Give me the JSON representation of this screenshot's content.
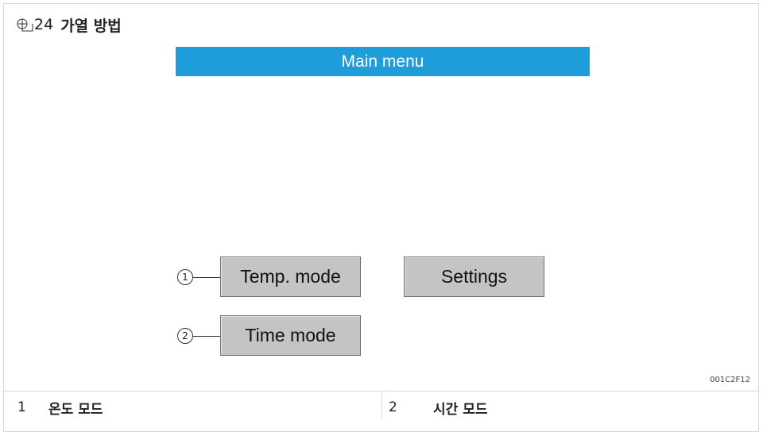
{
  "figure": {
    "number": "24",
    "title": "가열 방법",
    "code": "001C2F12"
  },
  "screen": {
    "menu_title": "Main menu",
    "buttons": {
      "temp_mode": "Temp. mode",
      "settings": "Settings",
      "time_mode": "Time mode"
    },
    "callouts": [
      "1",
      "2"
    ]
  },
  "legend": [
    {
      "number": "1",
      "text": "온도 모드"
    },
    {
      "number": "2",
      "text": "시간 모드"
    }
  ],
  "colors": {
    "menu_bar": "#1f9ddb",
    "button_face": "#c4c4c4"
  },
  "icons": {
    "figure_icon": "figure-icon"
  }
}
